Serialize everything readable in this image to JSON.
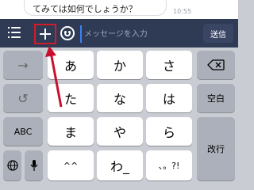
{
  "chat": {
    "message_text": "てみては如何でしょうか？",
    "timestamp": "10:55"
  },
  "input_bar": {
    "menu_icon": "list-menu-icon",
    "plus_icon": "plus-icon",
    "emoji_icon": "smile-icon",
    "placeholder": "メッセージを入力",
    "send_label": "送信",
    "highlight_color": "#d21b2b"
  },
  "keyboard": {
    "left_keys": [
      "→",
      "↺",
      "ABC"
    ],
    "globe_icon": "globe-icon",
    "mic_icon": "microphone-icon",
    "kana_rows": [
      [
        "あ",
        "か",
        "さ"
      ],
      [
        "た",
        "な",
        "は"
      ],
      [
        "ま",
        "や",
        "ら"
      ],
      [
        "^^",
        "わ_",
        "、。?!"
      ]
    ],
    "delete_icon": "backspace-icon",
    "space_label": "空白",
    "return_label": "改行"
  }
}
